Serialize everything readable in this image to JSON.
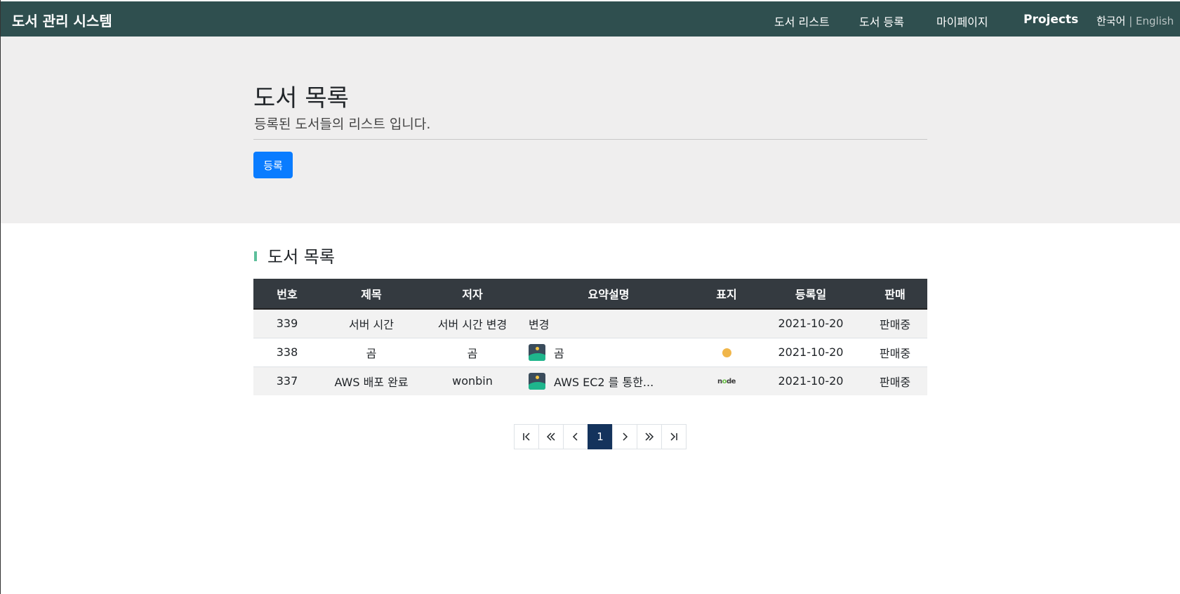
{
  "navbar": {
    "brand": "도서 관리 시스템",
    "links": {
      "book_list": "도서 리스트",
      "book_register": "도서 등록",
      "mypage": "마이페이지",
      "projects": "Projects"
    },
    "lang": {
      "ko": "한국어",
      "sep": "|",
      "en": "English"
    },
    "bg_color": "#2f4f4f"
  },
  "jumbotron": {
    "title": "도서 목록",
    "subtitle": "등록된 도서들의 리스트 입니다.",
    "register_button": "등록",
    "button_color": "#0a7cff"
  },
  "section": {
    "title": "도서 목록"
  },
  "table": {
    "headers": {
      "num": "번호",
      "title": "제목",
      "author": "저자",
      "summary": "요약설명",
      "cover": "표지",
      "date": "등록일",
      "sale": "판매"
    },
    "rows": [
      {
        "num": "339",
        "title": "서버 시간",
        "author": "서버 시간 변경",
        "summary": "변경",
        "summary_image": false,
        "cover": "none",
        "date": "2021-10-20",
        "sale": "판매중"
      },
      {
        "num": "338",
        "title": "곰",
        "author": "곰",
        "summary": "곰",
        "summary_image": true,
        "cover": "smile-icon",
        "date": "2021-10-20",
        "sale": "판매중"
      },
      {
        "num": "337",
        "title": "AWS 배포 완료",
        "author": "wonbin",
        "summary": "AWS EC2 를 통한...",
        "summary_image": true,
        "cover": "node-logo",
        "date": "2021-10-20",
        "sale": "판매중"
      }
    ]
  },
  "pagination": {
    "first_icon": "first-page-icon",
    "prev_group_icon": "double-chevron-left-icon",
    "prev_icon": "chevron-left-icon",
    "current": "1",
    "next_icon": "chevron-right-icon",
    "next_group_icon": "double-chevron-right-icon",
    "last_icon": "last-page-icon"
  }
}
